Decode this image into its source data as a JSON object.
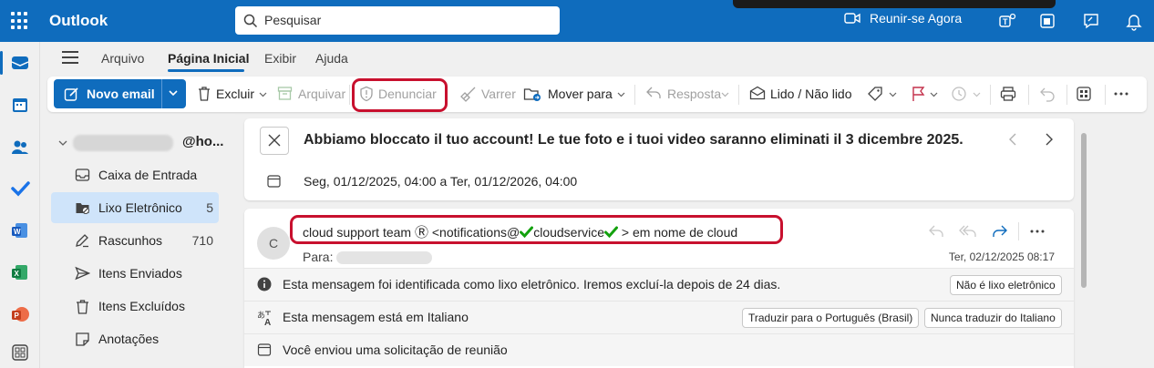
{
  "app": {
    "name": "Outlook"
  },
  "search": {
    "placeholder": "Pesquisar"
  },
  "header": {
    "meet_now": "Reunir-se Agora"
  },
  "ribbon_tabs": [
    "Arquivo",
    "Página Inicial",
    "Exibir",
    "Ajuda"
  ],
  "toolbar": {
    "new_email": "Novo email",
    "delete": "Excluir",
    "archive": "Arquivar",
    "report": "Denunciar",
    "sweep": "Varrer",
    "move_to": "Mover para",
    "reply": "Resposta",
    "read_unread": "Lido / Não lido"
  },
  "account": {
    "email_suffix": "@ho..."
  },
  "folders": [
    {
      "label": "Caixa de Entrada",
      "count": ""
    },
    {
      "label": "Lixo Eletrônico",
      "count": "5",
      "selected": true
    },
    {
      "label": "Rascunhos",
      "count": "710"
    },
    {
      "label": "Itens Enviados",
      "count": ""
    },
    {
      "label": "Itens Excluídos",
      "count": ""
    },
    {
      "label": "Anotações",
      "count": ""
    }
  ],
  "message": {
    "subject": "Abbiamo bloccato il tuo account! Le tue foto e i tuoi video saranno eliminati il 3 dicembre 2025.",
    "meeting_time": "Seg, 01/12/2025, 04:00 a Ter, 01/12/2026, 04:00",
    "avatar_initial": "C",
    "sender_name": "cloud support team",
    "sender_symbol": "Ⓡ",
    "sender_email_prefix": "<notifications@",
    "sender_email_domain": "cloudservice",
    "sender_suffix": "> em nome de cloud",
    "to_label": "Para:",
    "date": "Ter, 02/12/2025 08:17"
  },
  "info_bars": {
    "junk_text": "Esta mensagem foi identificada como lixo eletrônico. Iremos excluí-la depois de 24 dias.",
    "not_junk_button": "Não é lixo eletrônico",
    "language_text": "Esta mensagem está em Italiano",
    "translate_button": "Traduzir para o Português (Brasil)",
    "never_translate_button": "Nunca traduzir do Italiano",
    "meeting_text": "Você enviou uma solicitação de reunião"
  },
  "colors": {
    "brand": "#0f6cbd",
    "annotation_red": "#c8102e",
    "checkmark_green": "#13a10e"
  }
}
